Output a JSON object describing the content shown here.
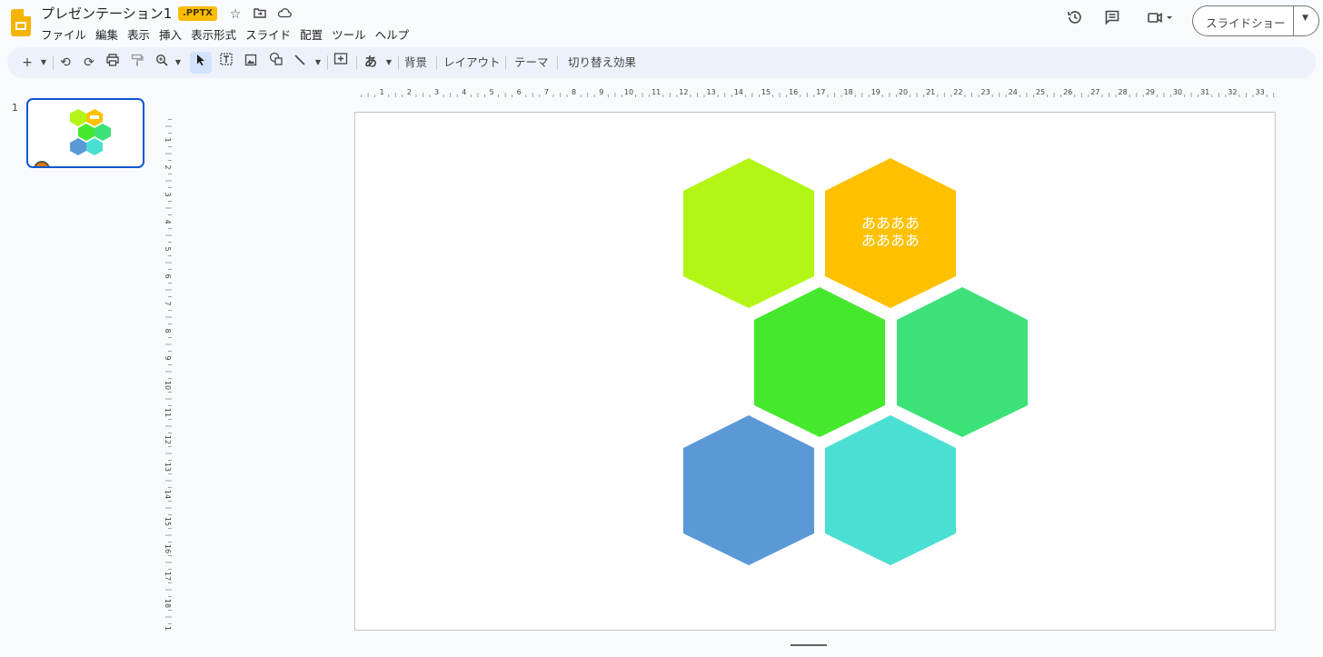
{
  "app": {
    "title": "プレゼンテーション1",
    "badge": ".PPTX"
  },
  "menu": [
    "ファイル",
    "編集",
    "表示",
    "挿入",
    "表示形式",
    "スライド",
    "配置",
    "ツール",
    "ヘルプ"
  ],
  "header": {
    "slideshow_label": "スライドショー"
  },
  "toolbar": {
    "background_label": "背景",
    "layout_label": "レイアウト",
    "theme_label": "テーマ",
    "transition_label": "切り替え効果",
    "ime_label": "あ"
  },
  "filmstrip": {
    "slide_number": "1"
  },
  "ruler": {
    "h_ticks": [
      "1",
      "2",
      "3",
      "4",
      "5",
      "6",
      "7",
      "8",
      "9",
      "10",
      "11",
      "12",
      "13",
      "14",
      "15",
      "16",
      "17",
      "18",
      "19",
      "20",
      "21",
      "22",
      "23",
      "24",
      "25",
      "26",
      "27",
      "28",
      "29",
      "30",
      "31",
      "32",
      "33"
    ],
    "v_ticks": [
      "1",
      "2",
      "3",
      "4",
      "5",
      "6",
      "7",
      "8",
      "9",
      "10",
      "11",
      "12",
      "13",
      "14",
      "15",
      "16",
      "17",
      "18",
      "19"
    ]
  },
  "slide": {
    "hex_text_line1": "ああああ",
    "hex_text_line2": "ああああ",
    "colors": {
      "lime": "#b3f615",
      "orange": "#ffc000",
      "green": "#45e82d",
      "mint": "#3ce278",
      "blue": "#5b99d6",
      "teal": "#4adfd2"
    }
  },
  "theme": {
    "accent": "#0b57d0",
    "toolbar_bg": "#edf2fa",
    "page_bg": "#f8fafd"
  }
}
